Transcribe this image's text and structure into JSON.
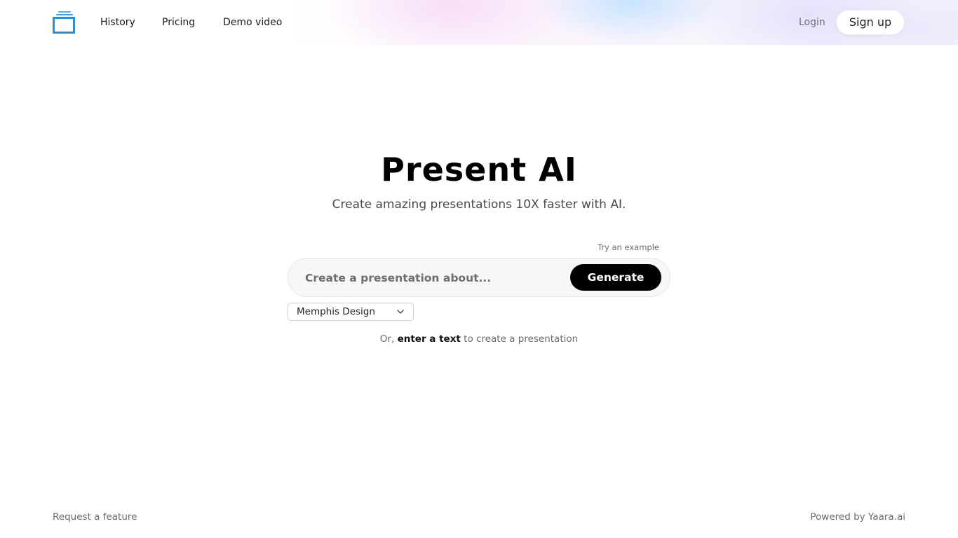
{
  "header": {
    "logo_icon": "stacked-slides-icon",
    "nav": [
      {
        "label": "History"
      },
      {
        "label": "Pricing"
      },
      {
        "label": "Demo video"
      }
    ],
    "login_label": "Login",
    "signup_label": "Sign up"
  },
  "hero": {
    "title": "Present AI",
    "subtitle": "Create amazing presentations 10X faster with AI."
  },
  "prompt": {
    "try_example_label": "Try an example",
    "placeholder": "Create a presentation about...",
    "value": "",
    "generate_label": "Generate"
  },
  "theme": {
    "selected": "Memphis Design",
    "icon": "chevron-down-icon"
  },
  "alt_action": {
    "prefix": "Or, ",
    "link": "enter a text",
    "suffix": " to create a presentation"
  },
  "footer": {
    "left": "Request a feature",
    "right": "Powered by Yaara.ai"
  },
  "colors": {
    "logo_blue": "#2a8fd8",
    "generate_bg": "#000000",
    "text_muted": "#6b6b6b"
  }
}
